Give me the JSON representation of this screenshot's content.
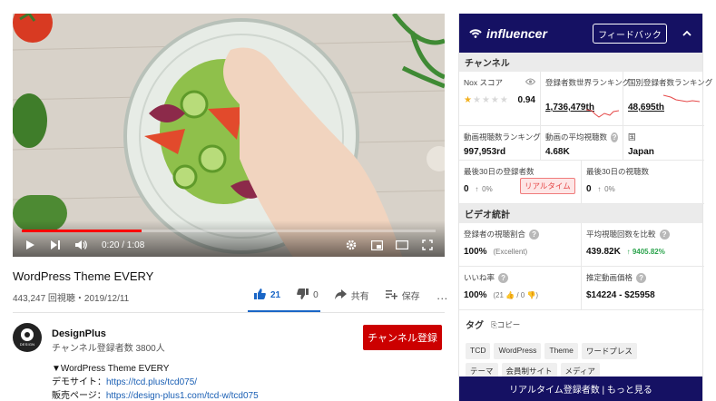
{
  "player": {
    "time": "0:20 / 1:08",
    "progress_fraction": 0.29
  },
  "video": {
    "title": "WordPress Theme EVERY",
    "meta": "443,247 回視聴・2019/12/11",
    "likes": "21",
    "dislikes": "0",
    "share_label": "共有",
    "save_label": "保存",
    "more_label": "…"
  },
  "channel": {
    "name": "DesignPlus",
    "avatar_text": "DESIGN",
    "subscribers": "チャンネル登録者数 3800人",
    "subscribe_label": "チャンネル登録"
  },
  "description": {
    "line1": "▼WordPress Theme EVERY",
    "demo_label": "デモサイト：",
    "demo_url": "https://tcd.plus/tcd075/",
    "sales_label": "販売ページ：",
    "sales_url": "https://design-plus1.com/tcd-w/tcd075"
  },
  "panel": {
    "brand": "influencer",
    "feedback_label": "フィードバック",
    "channel_section": "チャンネル",
    "nox_label": "Nox スコア",
    "nox_value": "0.94",
    "nox_stars": 0.5,
    "world_rank_label": "登録者数世界ランキング",
    "world_rank_value": "1,736,479th",
    "country_rank_label": "国別登録者数ランキング",
    "country_rank_value": "48,695th",
    "view_rank_label": "動画視聴数ランキング",
    "view_rank_value": "997,953rd",
    "avg_views_label": "動画の平均視聴数",
    "avg_views_value": "4.68K",
    "country_label": "国",
    "country_value": "Japan",
    "subs30_label": "最後30日の登録者数",
    "subs30_value": "0",
    "subs30_pct": "0%",
    "realtime_badge": "リアルタイム",
    "views30_label": "最後30日の視聴数",
    "views30_value": "0",
    "views30_pct": "0%",
    "video_section": "ビデオ統計",
    "sub_view_ratio_label": "登録者の視聴割合",
    "sub_view_ratio_value": "100%",
    "sub_view_ratio_note": "(Excellent)",
    "avg_compare_label": "平均視聴回数を比較",
    "avg_compare_value": "439.82K",
    "avg_compare_delta": "↑ 9405.82%",
    "like_rate_label": "いいね率",
    "like_rate_value": "100%",
    "like_rate_note": "(21 👍 / 0 👎)",
    "ad_price_label": "推定動画価格",
    "ad_price_value": "$14224 - $25958",
    "tags_label": "タグ",
    "copy_label": "⎘コピー",
    "tags": [
      "TCD",
      "WordPress",
      "Theme",
      "ワードプレス",
      "テーマ",
      "会員制サイト",
      "メディア"
    ],
    "footer_label": "リアルタイム登録者数 | もっと見る"
  },
  "colors": {
    "panel_navy": "#151163",
    "subscribe_red": "#cc0000",
    "like_blue": "#1a66c6",
    "link_blue": "#1a5fb4",
    "progress_red": "#ff0000"
  }
}
